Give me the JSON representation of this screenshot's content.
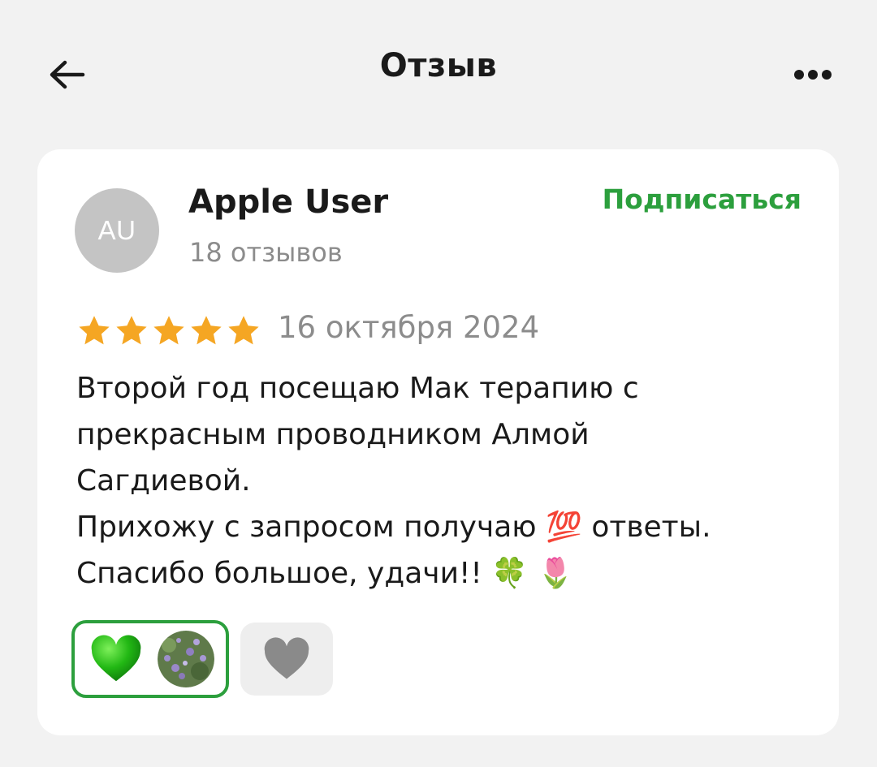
{
  "header": {
    "title": "Отзыв",
    "back_icon": "arrow-left-icon",
    "more_icon": "more-dots-icon"
  },
  "review": {
    "author": {
      "initials": "AU",
      "name": "Apple User",
      "review_count": "18 отзывов"
    },
    "subscribe_label": "Подписаться",
    "rating": 5,
    "rating_max": 5,
    "date": "16 октября 2024",
    "text_lines": [
      "Второй год посещаю Мак терапию с",
      "прекрасным проводником Алмой",
      "Сагдиевой.",
      "Прихожу с запросом получаю 💯 ответы.",
      "Спасибо большое, удачи!! 🍀 🌷"
    ],
    "reactions": {
      "active_emoji_icon": "green-heart-icon",
      "add_reaction_icon": "heart-icon"
    }
  },
  "colors": {
    "background": "#f2f2f2",
    "card": "#ffffff",
    "accent_green": "#2c9f3d",
    "star_gold": "#f5a623",
    "muted_text": "#8c8c8c",
    "avatar_gray": "#c4c4c4"
  }
}
